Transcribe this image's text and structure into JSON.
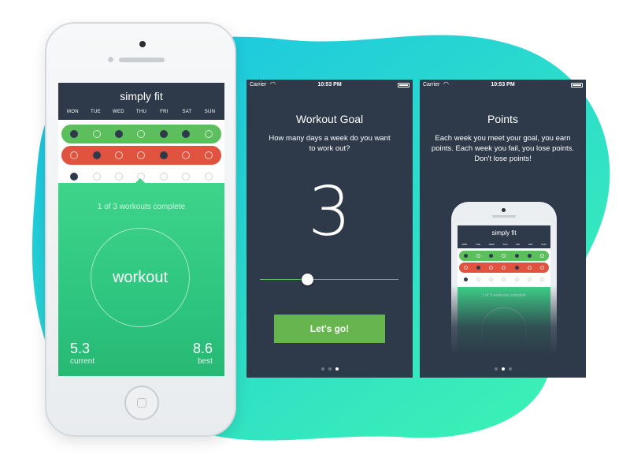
{
  "colors": {
    "navy": "#2e3a4a",
    "green": "#2ecc71",
    "pill_green": "#5cbe5c",
    "pill_red": "#e0533f",
    "button_green": "#66b54f",
    "blob_start": "#17c1e8",
    "blob_end": "#3ff5b0"
  },
  "app": {
    "title": "simply fit",
    "days": [
      "MON",
      "TUE",
      "WED",
      "THU",
      "FRI",
      "SAT",
      "SUN"
    ],
    "weeks": [
      {
        "status": "met",
        "filled": [
          true,
          false,
          true,
          false,
          true,
          true,
          false
        ]
      },
      {
        "status": "failed",
        "filled": [
          false,
          true,
          false,
          false,
          true,
          false,
          false
        ]
      },
      {
        "status": "current",
        "filled": [
          true,
          false,
          false,
          false,
          false,
          false,
          false
        ]
      }
    ],
    "progress_text": "1 of 3 workouts complete",
    "workout_button": "workout",
    "current_value": "5.3",
    "current_label": "current",
    "best_value": "8.6",
    "best_label": "best"
  },
  "status_bar": {
    "carrier": "Carrier",
    "time": "10:53 PM"
  },
  "goal_screen": {
    "title": "Workout Goal",
    "question": "How many days a week do you want to work out?",
    "value": "3",
    "slider_fraction": 0.35,
    "button_label": "Let's go!",
    "page_index": 2,
    "page_count": 3
  },
  "points_screen": {
    "title": "Points",
    "description": "Each week you meet your goal, you earn points. Each week you fail, you lose points. Don't lose points!",
    "page_index": 1,
    "page_count": 3
  }
}
